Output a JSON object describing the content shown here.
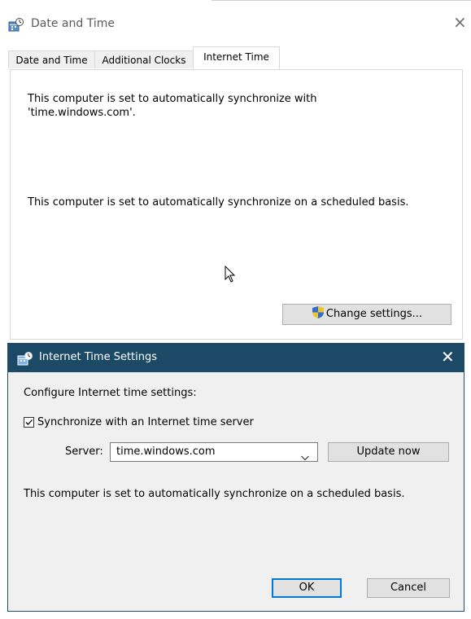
{
  "back_window": {
    "title": "Date and Time",
    "close_glyph": "×",
    "tabs": [
      {
        "label": "Date and Time",
        "active": false
      },
      {
        "label": "Additional Clocks",
        "active": false
      },
      {
        "label": "Internet Time",
        "active": true
      }
    ],
    "sync_line1": "This computer is set to automatically synchronize with",
    "sync_line2": "'time.windows.com'.",
    "schedule_text": "This computer is set to automatically synchronize on a scheduled basis.",
    "change_settings_label": "Change settings..."
  },
  "dialog": {
    "title": "Internet Time Settings",
    "close_glyph": "✕",
    "configure_label": "Configure Internet time settings:",
    "sync_checkbox_label": "Synchronize with an Internet time server",
    "sync_checked": true,
    "server_label": "Server:",
    "server_value": "time.windows.com",
    "update_now_label": "Update now",
    "status_text": "This computer is set to automatically synchronize on a scheduled basis.",
    "ok_label": "OK",
    "cancel_label": "Cancel"
  },
  "colors": {
    "dialog_titlebar": "#1c4a66",
    "dialog_bg": "#f0f0f0",
    "default_button_border": "#0078d7"
  },
  "icons": [
    "date-time-app-icon",
    "close-icon",
    "shield-icon",
    "mouse-cursor-icon",
    "checkmark-icon",
    "chevron-down-icon"
  ]
}
